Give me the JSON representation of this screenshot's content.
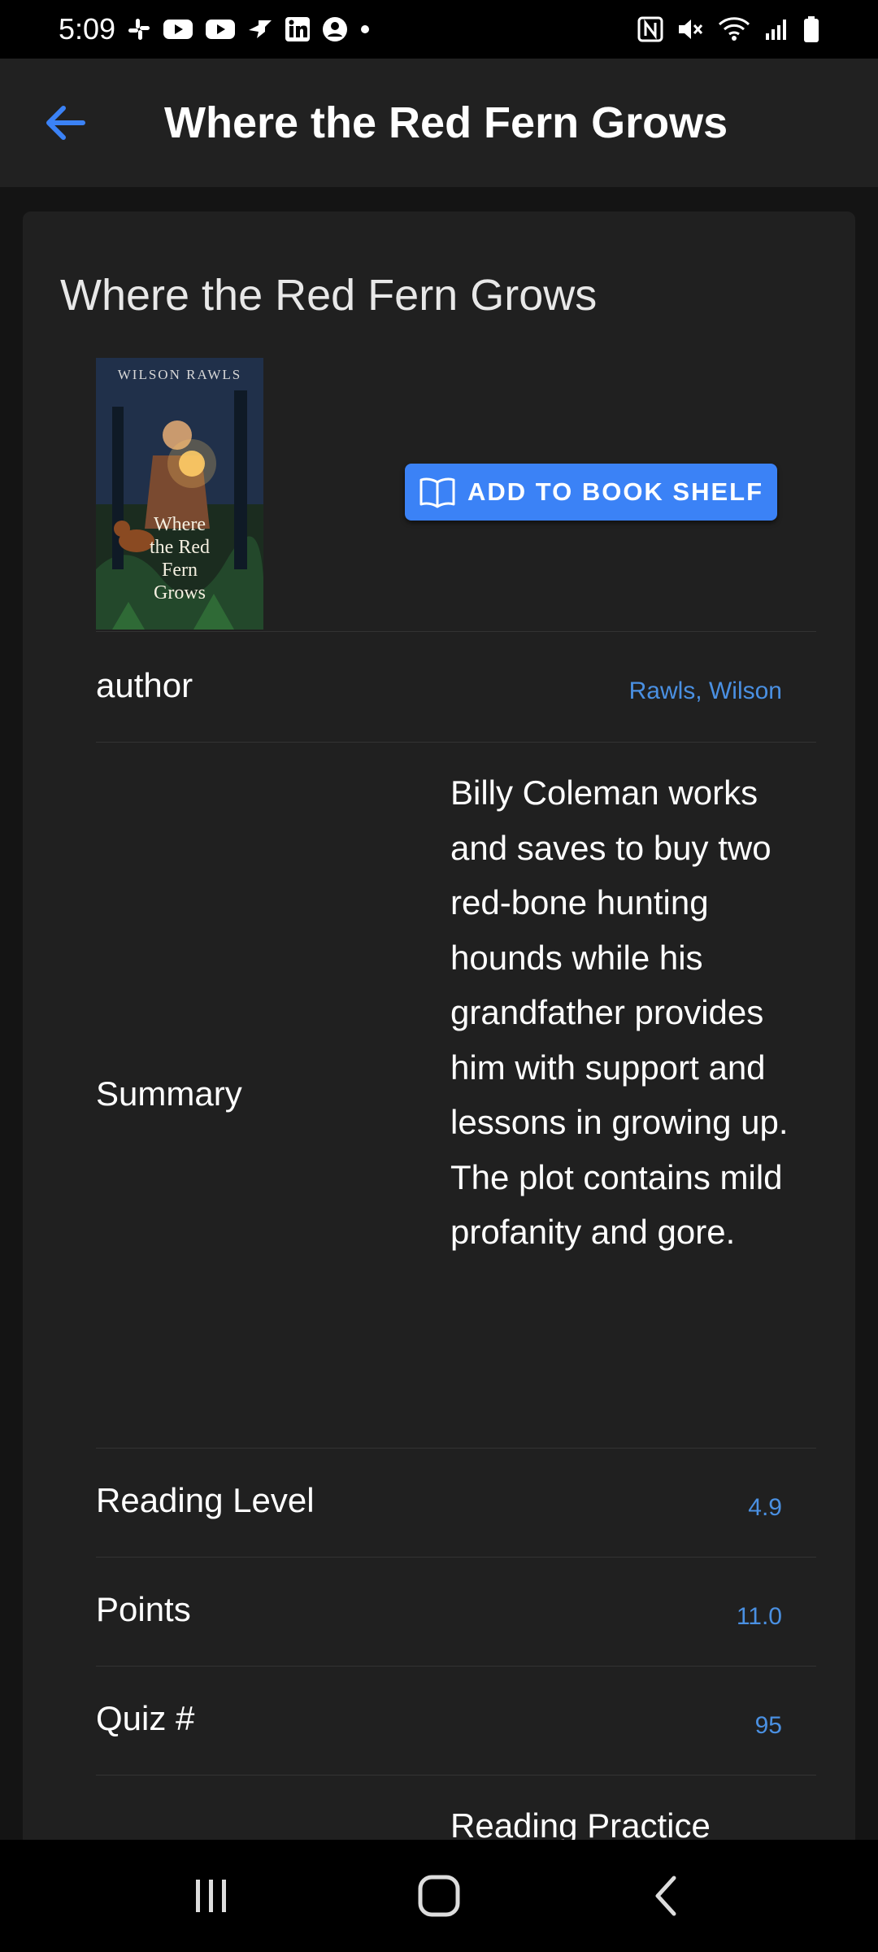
{
  "status_bar": {
    "time": "5:09",
    "left_icons": [
      "slack-icon",
      "youtube-icon",
      "youtube-icon",
      "bird-icon",
      "linkedin-icon",
      "account-icon",
      "dot-icon"
    ],
    "right_icons": [
      "nfc-icon",
      "mute-icon",
      "wifi-icon",
      "signal-icon",
      "battery-icon"
    ]
  },
  "app_bar": {
    "title": "Where the Red Fern Grows",
    "back_icon": "arrow-left-icon"
  },
  "book": {
    "title": "Where the Red Fern Grows",
    "cover": {
      "author_text": "WILSON RAWLS",
      "title_lines": [
        "Where",
        "the Red",
        "Fern",
        "Grows"
      ]
    },
    "add_button_label": "ADD TO BOOK SHELF",
    "details": {
      "author_label": "author",
      "author_value": "Rawls, Wilson",
      "summary_label": "Summary",
      "summary_value": "Billy Coleman works and saves to buy two red-bone hunting hounds while his grandfather provides him with support and lessons in growing up. The plot contains mild profanity and gore.",
      "reading_level_label": "Reading Level",
      "reading_level_value": "4.9",
      "points_label": "Points",
      "points_value": "11.0",
      "quiz_label": "Quiz #",
      "quiz_value": "95",
      "next_value_partial": "Reading Practice"
    }
  },
  "colors": {
    "accent": "#3B82F6",
    "link": "#4A90E2",
    "background": "#121212",
    "card": "#202020",
    "app_bar": "#212121"
  }
}
